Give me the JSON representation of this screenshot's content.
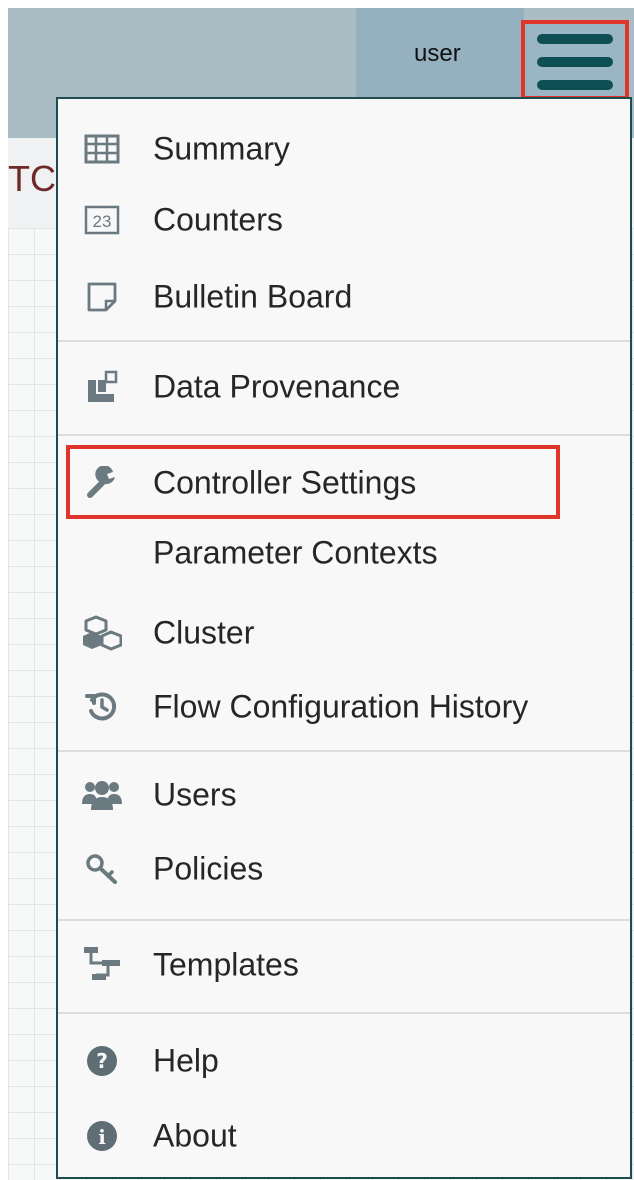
{
  "header": {
    "user_label": "user",
    "partial_text": "TC",
    "hamburger_icon": "hamburger-menu-icon"
  },
  "menu": {
    "items": [
      {
        "label": "Summary",
        "icon": "table-icon"
      },
      {
        "label": "Counters",
        "icon": "counter-icon"
      },
      {
        "label": "Bulletin Board",
        "icon": "sticky-note-icon"
      },
      {
        "label": "Data Provenance",
        "icon": "provenance-icon"
      },
      {
        "label": "Controller Settings",
        "icon": "wrench-icon"
      },
      {
        "label": "Parameter Contexts",
        "icon": ""
      },
      {
        "label": "Cluster",
        "icon": "cubes-icon"
      },
      {
        "label": "Flow Configuration History",
        "icon": "history-icon"
      },
      {
        "label": "Users",
        "icon": "users-icon"
      },
      {
        "label": "Policies",
        "icon": "key-icon"
      },
      {
        "label": "Templates",
        "icon": "templates-icon"
      },
      {
        "label": "Help",
        "icon": "question-circle-icon"
      },
      {
        "label": "About",
        "icon": "info-circle-icon"
      }
    ]
  },
  "colors": {
    "highlight_border": "#e0352b",
    "hamburger_bars": "#0e4f55",
    "menu_border": "#1e4c50",
    "menu_icon": "#6b7a80"
  }
}
